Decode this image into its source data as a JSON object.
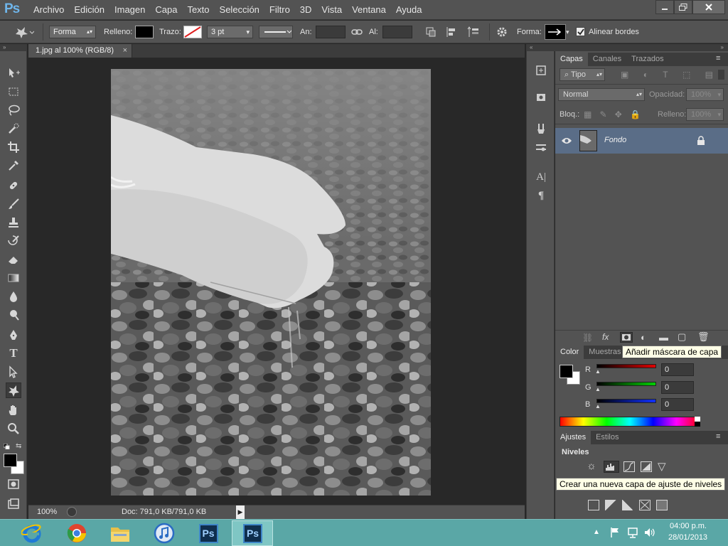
{
  "app": {
    "logo": "Ps"
  },
  "menu": [
    "Archivo",
    "Edición",
    "Imagen",
    "Capa",
    "Texto",
    "Selección",
    "Filtro",
    "3D",
    "Vista",
    "Ventana",
    "Ayuda"
  ],
  "options": {
    "mode": "Forma",
    "fill_label": "Relleno:",
    "stroke_label": "Trazo:",
    "stroke_width": "3 pt",
    "width_label": "An:",
    "height_label": "Al:",
    "shape_label": "Forma:",
    "align_edges": "Alinear bordes",
    "align_edges_checked": true
  },
  "document": {
    "tab_title": "1.jpg al 100% (RGB/8)",
    "zoom": "100%",
    "doc_info": "Doc: 791,0 KB/791,0 KB"
  },
  "layers_panel": {
    "tabs": [
      "Capas",
      "Canales",
      "Trazados"
    ],
    "kind_filter": "Tipo",
    "blend_mode": "Normal",
    "opacity_label": "Opacidad:",
    "opacity": "100%",
    "lock_label": "Bloq.:",
    "fill_label": "Relleno:",
    "fill": "100%",
    "layers": [
      {
        "name": "Fondo",
        "visible": true,
        "locked": true
      }
    ],
    "tooltip": "Añadir máscara de capa"
  },
  "color_panel": {
    "tabs": [
      "Color",
      "Muestras"
    ],
    "r_label": "R",
    "g_label": "G",
    "b_label": "B",
    "r": "0",
    "g": "0",
    "b": "0"
  },
  "adjustments_panel": {
    "tabs": [
      "Ajustes",
      "Estilos"
    ],
    "heading": "Niveles",
    "tooltip": "Crear una nueva capa de ajuste de niveles"
  },
  "taskbar": {
    "clock_time": "04:00 p.m.",
    "clock_date": "28/01/2013",
    "ps_label_1": "Ps",
    "ps_label_2": "Ps"
  },
  "colors": {
    "accent": "#6fb5ea",
    "taskbar": "#5aa7a6",
    "layer_selected": "#5a6d87"
  }
}
